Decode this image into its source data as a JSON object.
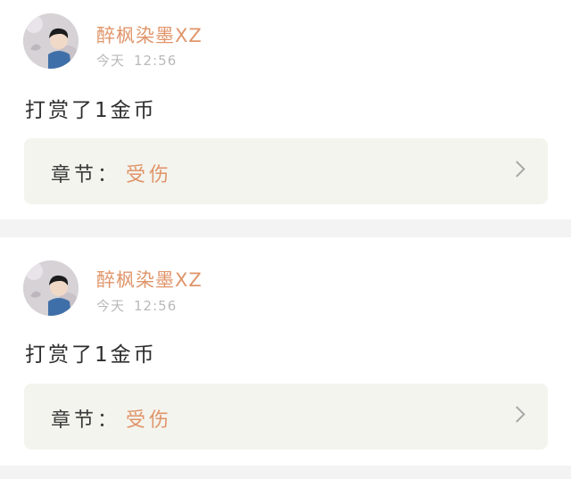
{
  "entries": [
    {
      "username": "醉枫染墨XZ",
      "date_label": "今天",
      "time": "12:56",
      "message": "打赏了1金币",
      "chapter_label": "章节",
      "chapter_separator": "：",
      "chapter_name": "受伤"
    },
    {
      "username": "醉枫染墨XZ",
      "date_label": "今天",
      "time": "12:56",
      "message": "打赏了1金币",
      "chapter_label": "章节",
      "chapter_separator": "：",
      "chapter_name": "受伤"
    }
  ],
  "colors": {
    "username": "#e0956a",
    "chapter_name": "#e0956a",
    "chapter_box_bg": "#f4f4ee",
    "page_bg": "#f3f3f3"
  },
  "icons": {
    "avatar": "user-avatar-photo",
    "chevron": "chevron-right-icon"
  }
}
